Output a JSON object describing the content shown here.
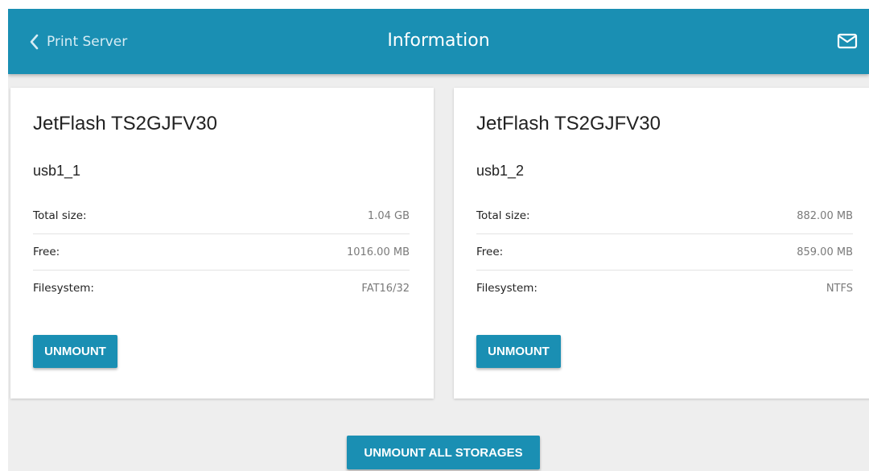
{
  "header": {
    "back_label": "Print Server",
    "title": "Information",
    "icons": {
      "back": "chevron-left-icon",
      "mail": "mail-icon"
    },
    "colors": {
      "background": "#1a8fb3",
      "title": "#ffffff"
    }
  },
  "storages": [
    {
      "device": "JetFlash TS2GJFV30",
      "partition": "usb1_1",
      "rows": [
        {
          "label": "Total size:",
          "value": "1.04 GB"
        },
        {
          "label": "Free:",
          "value": "1016.00 MB"
        },
        {
          "label": "Filesystem:",
          "value": "FAT16/32"
        }
      ],
      "button_label": "UNMOUNT"
    },
    {
      "device": "JetFlash TS2GJFV30",
      "partition": "usb1_2",
      "rows": [
        {
          "label": "Total size:",
          "value": "882.00 MB"
        },
        {
          "label": "Free:",
          "value": "859.00 MB"
        },
        {
          "label": "Filesystem:",
          "value": "NTFS"
        }
      ],
      "button_label": "UNMOUNT"
    }
  ],
  "footer": {
    "unmount_all_label": "UNMOUNT ALL STORAGES"
  },
  "colors": {
    "accent": "#1a8fb3",
    "page_background": "#eeeeee",
    "card_background": "#ffffff"
  }
}
